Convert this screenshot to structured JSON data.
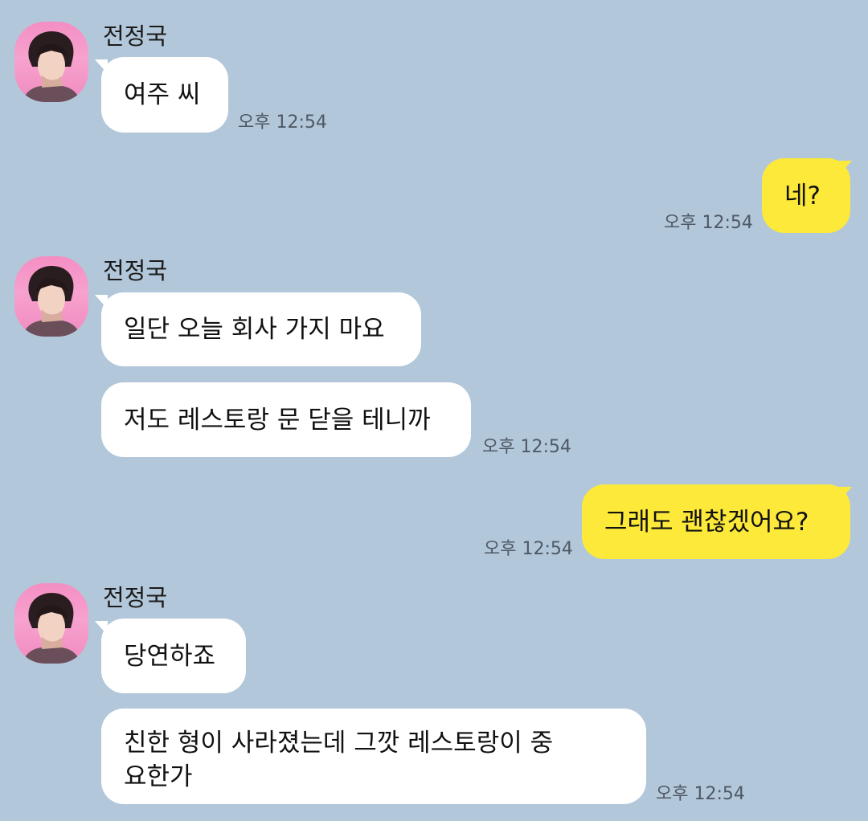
{
  "contact": {
    "name": "전정국"
  },
  "messages": [
    {
      "sender": "them",
      "text": "여주 씨",
      "time": "오후 12:54"
    },
    {
      "sender": "me",
      "text": "네?",
      "time": "오후 12:54"
    },
    {
      "sender": "them",
      "text": "일단 오늘 회사 가지 마요"
    },
    {
      "sender": "them",
      "text": "저도 레스토랑 문 닫을 테니까",
      "time": "오후 12:54"
    },
    {
      "sender": "me",
      "text": "그래도 괜찮겠어요?",
      "time": "오후 12:54"
    },
    {
      "sender": "them",
      "text": "당연하죠"
    },
    {
      "sender": "them",
      "text": "친한 형이 사라졌는데 그깟 레스토랑이 중요한가",
      "time": "오후 12:54"
    }
  ],
  "colors": {
    "background": "#b2c7da",
    "incoming_bubble": "#ffffff",
    "outgoing_bubble": "#fde93a"
  }
}
